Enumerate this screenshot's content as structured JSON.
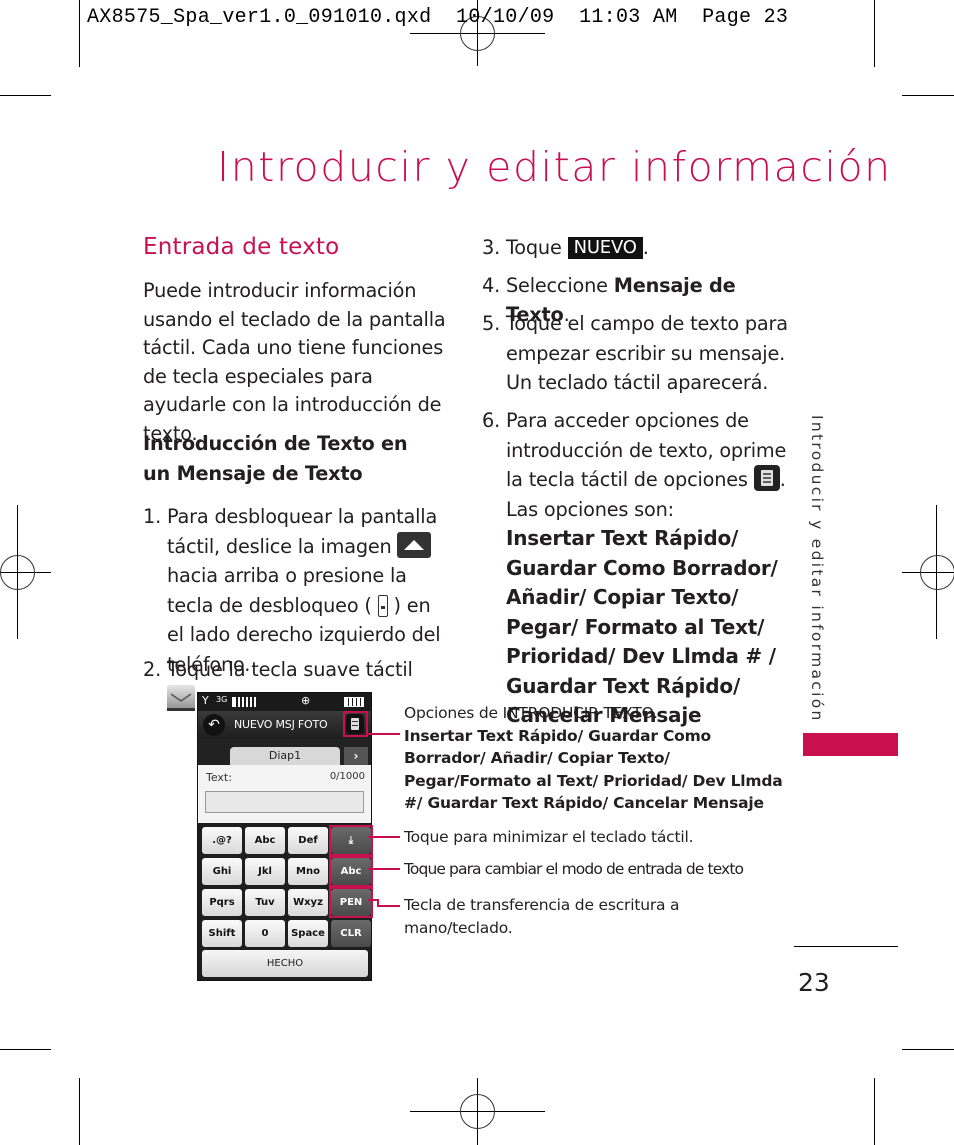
{
  "slug": "AX8575_Spa_ver1.0_091010.qxd  10/10/09  11:03 AM  Page 23",
  "page_title": "Introducir y editar información",
  "section": {
    "title": "Entrada de texto",
    "intro": "Puede introducir información usando el teclado de la pantalla táctil. Cada uno tiene funciones de tecla especiales para ayudarle con la introducción de texto.",
    "subheading": "Introducción de Texto en un Mensaje de Texto"
  },
  "steps": {
    "s1": {
      "num": "1.",
      "text_a": "Para desbloquear la pantalla táctil, deslice la imagen",
      "text_b": "hacia arriba o presione la tecla de desbloqueo (",
      "text_c": ") en el lado derecho izquierdo del teléfono."
    },
    "s2": {
      "num": "2.",
      "text": "Toque la tecla suave táctil",
      "end": "."
    },
    "s3": {
      "num": "3.",
      "text": "Toque",
      "chip": "NUEVO",
      "end": "."
    },
    "s4": {
      "num": "4.",
      "text": "Seleccione",
      "bold": "Mensaje de Texto",
      "end": "."
    },
    "s5": {
      "num": "5.",
      "text": "Toque el campo de texto para empezar escribir su mensaje. Un teclado táctil aparecerá."
    },
    "s6": {
      "num": "6.",
      "text_a": "Para acceder opciones de introducción de texto, oprime la tecla táctil de opciones",
      "text_b": ". Las opciones son:",
      "options": "Insertar Text Rápido/ Guardar Como Borrador/ Añadir/ Copiar Texto/ Pegar/ Formato al Text/ Prioridad/ Dev Llmda # / Guardar Text Rápido/ Cancelar Mensaje"
    }
  },
  "phone": {
    "status_icons": [
      "signal-icon",
      "3g-1x-icon",
      "signal-bars-icon",
      "gps-icon",
      "battery-icon"
    ],
    "status_text": {
      "net": "3G",
      "gps": "⊕"
    },
    "header_title": "NUEVO MSJ FOTO",
    "tab_label": "Diap1",
    "tab_next": "›",
    "text_label": "Text:",
    "text_count": "0/1000",
    "keys": [
      [
        ".@?",
        "Abc",
        "Def",
        "⤓"
      ],
      [
        "Ghi",
        "Jkl",
        "Mno",
        "Abc"
      ],
      [
        "Pqrs",
        "Tuv",
        "Wxyz",
        "PEN"
      ],
      [
        "Shift",
        "0",
        "Space",
        "CLR"
      ]
    ],
    "done_label": "HECHO"
  },
  "callouts": {
    "options_title": "Opciones de INTRODUCIR TEXTO.",
    "options_list": "Insertar Text Rápido/ Guardar Como Borrador/ Añadir/ Copiar Texto/ Pegar/Formato al Text/ Prioridad/ Dev Llmda #/ Guardar Text Rápido/ Cancelar Mensaje",
    "minimize": "Toque para minimizar el teclado táctil.",
    "mode": "Toque para cambiar el modo de entrada de texto",
    "pen": "Tecla de transferencia de escritura a mano/teclado."
  },
  "side_tab": "Introducir y editar información",
  "page_number": "23",
  "colors": {
    "accent": "#c8104e",
    "text": "#231f20"
  }
}
